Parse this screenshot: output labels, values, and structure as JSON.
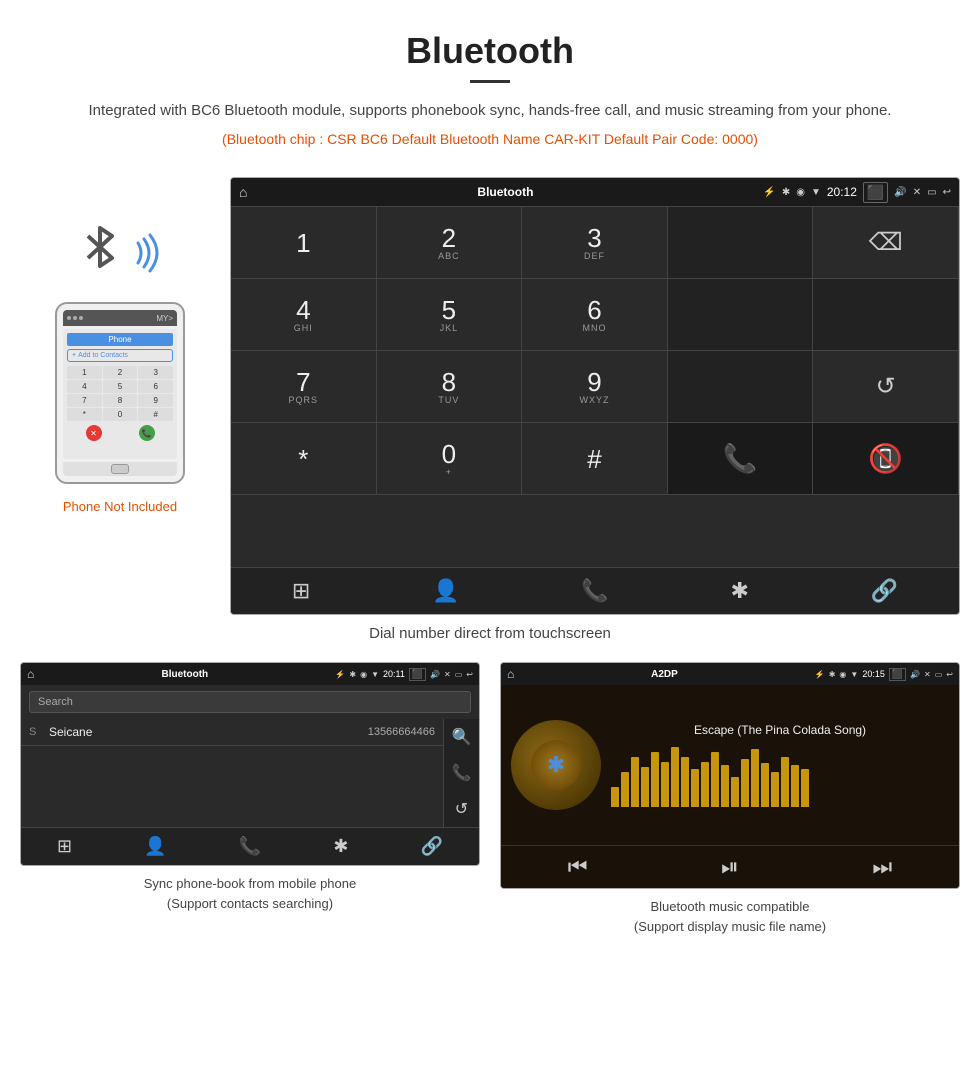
{
  "header": {
    "title": "Bluetooth",
    "description": "Integrated with BC6 Bluetooth module, supports phonebook sync, hands-free call, and music streaming from your phone.",
    "bt_info": "(Bluetooth chip : CSR BC6    Default Bluetooth Name CAR-KIT    Default Pair Code: 0000)"
  },
  "phone_label": "Phone Not Included",
  "car_display": {
    "status_bar": {
      "app_name": "Bluetooth",
      "time": "20:12"
    },
    "dialpad": {
      "keys": [
        {
          "num": "1",
          "sub": ""
        },
        {
          "num": "2",
          "sub": "ABC"
        },
        {
          "num": "3",
          "sub": "DEF"
        },
        {
          "num": "",
          "sub": ""
        },
        {
          "num": "⌫",
          "sub": ""
        },
        {
          "num": "4",
          "sub": "GHI"
        },
        {
          "num": "5",
          "sub": "JKL"
        },
        {
          "num": "6",
          "sub": "MNO"
        },
        {
          "num": "",
          "sub": ""
        },
        {
          "num": "",
          "sub": ""
        },
        {
          "num": "7",
          "sub": "PQRS"
        },
        {
          "num": "8",
          "sub": "TUV"
        },
        {
          "num": "9",
          "sub": "WXYZ"
        },
        {
          "num": "",
          "sub": ""
        },
        {
          "num": "↺",
          "sub": ""
        },
        {
          "num": "*",
          "sub": ""
        },
        {
          "num": "0",
          "sub": "+"
        },
        {
          "num": "#",
          "sub": ""
        },
        {
          "num": "📞",
          "sub": ""
        },
        {
          "num": "📵",
          "sub": ""
        }
      ],
      "bottom_icons": [
        "⊞",
        "👤",
        "📞",
        "✱",
        "🔗"
      ]
    }
  },
  "caption_main": "Dial number direct from touchscreen",
  "phonebook_panel": {
    "status_bar": {
      "app_name": "Bluetooth",
      "time": "20:11"
    },
    "search_placeholder": "Search",
    "contacts": [
      {
        "letter": "S",
        "name": "Seicane",
        "number": "13566664466"
      }
    ],
    "bottom_icons": [
      "⊞",
      "👤",
      "📞",
      "✱",
      "🔗"
    ],
    "side_icons": [
      "🔍",
      "📞",
      "↺"
    ]
  },
  "caption_phonebook_line1": "Sync phone-book from mobile phone",
  "caption_phonebook_line2": "(Support contacts searching)",
  "music_panel": {
    "status_bar": {
      "app_name": "A2DP",
      "time": "20:15"
    },
    "song_title": "Escape (The Pina Colada Song)",
    "eq_bars": [
      20,
      35,
      50,
      40,
      55,
      45,
      60,
      50,
      38,
      45,
      55,
      42,
      30,
      48,
      58,
      44,
      35,
      50,
      42,
      38
    ],
    "controls": [
      "⏮",
      "⏯",
      "⏭"
    ]
  },
  "caption_music_line1": "Bluetooth music compatible",
  "caption_music_line2": "(Support display music file name)"
}
